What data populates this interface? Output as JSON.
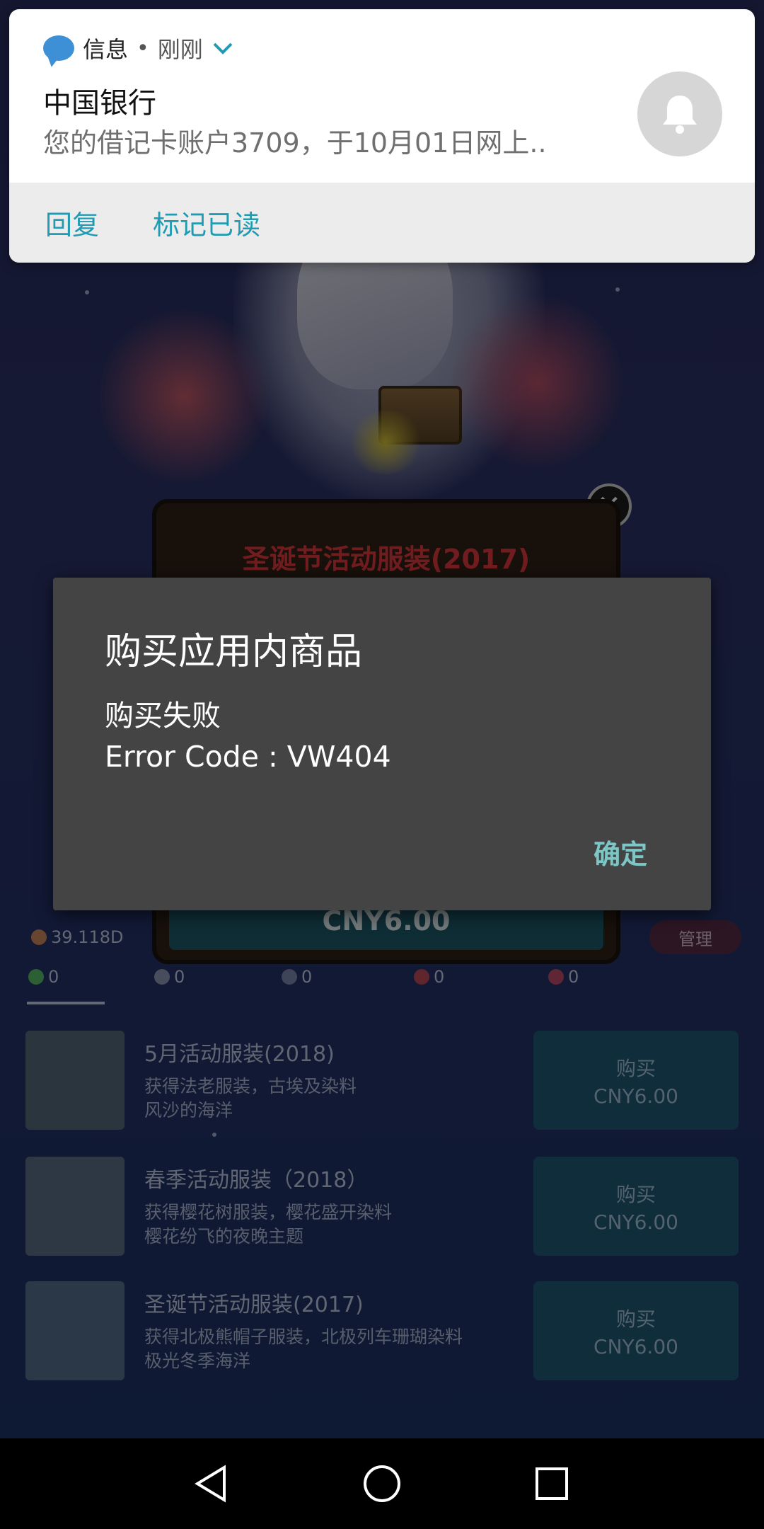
{
  "notification": {
    "app_name": "信息",
    "separator": "•",
    "time": "刚刚",
    "sender": "中国银行",
    "body": "您的借记卡账户3709，于10月01日网上..",
    "actions": [
      "回复",
      "标记已读"
    ],
    "icons": {
      "app": "message-bubble-icon",
      "expand": "chevron-down-icon",
      "avatar": "bell-icon"
    }
  },
  "dialog": {
    "title": "购买应用内商品",
    "message_line1": "购买失败",
    "message_line2": "Error Code : VW404",
    "ok_label": "确定"
  },
  "game": {
    "panel_title": "圣诞节活动服装(2017)",
    "panel_price": "CNY6.00",
    "stats": {
      "currency": "39.118D",
      "counters": [
        "0",
        "0",
        "0",
        "0",
        "0"
      ],
      "manage_label": "管理"
    },
    "items": [
      {
        "title": "5月活动服装(2018)",
        "desc": "获得法老服装，古埃及染料\n风沙的海洋",
        "buy_label": "购买",
        "price": "CNY6.00"
      },
      {
        "title": "春季活动服装（2018）",
        "desc": "获得樱花树服装，樱花盛开染料\n樱花纷飞的夜晚主题",
        "buy_label": "购买",
        "price": "CNY6.00"
      },
      {
        "title": "圣诞节活动服装(2017)",
        "desc": "获得北极熊帽子服装，北极列车珊瑚染料\n极光冬季海洋",
        "buy_label": "购买",
        "price": "CNY6.00"
      }
    ]
  },
  "navbar": {
    "icons": [
      "back-icon",
      "home-icon",
      "recents-icon"
    ]
  },
  "colors": {
    "accent": "#1f9bb3",
    "dialog_ok": "#7cc6c6",
    "dialog_bg": "#444444"
  }
}
